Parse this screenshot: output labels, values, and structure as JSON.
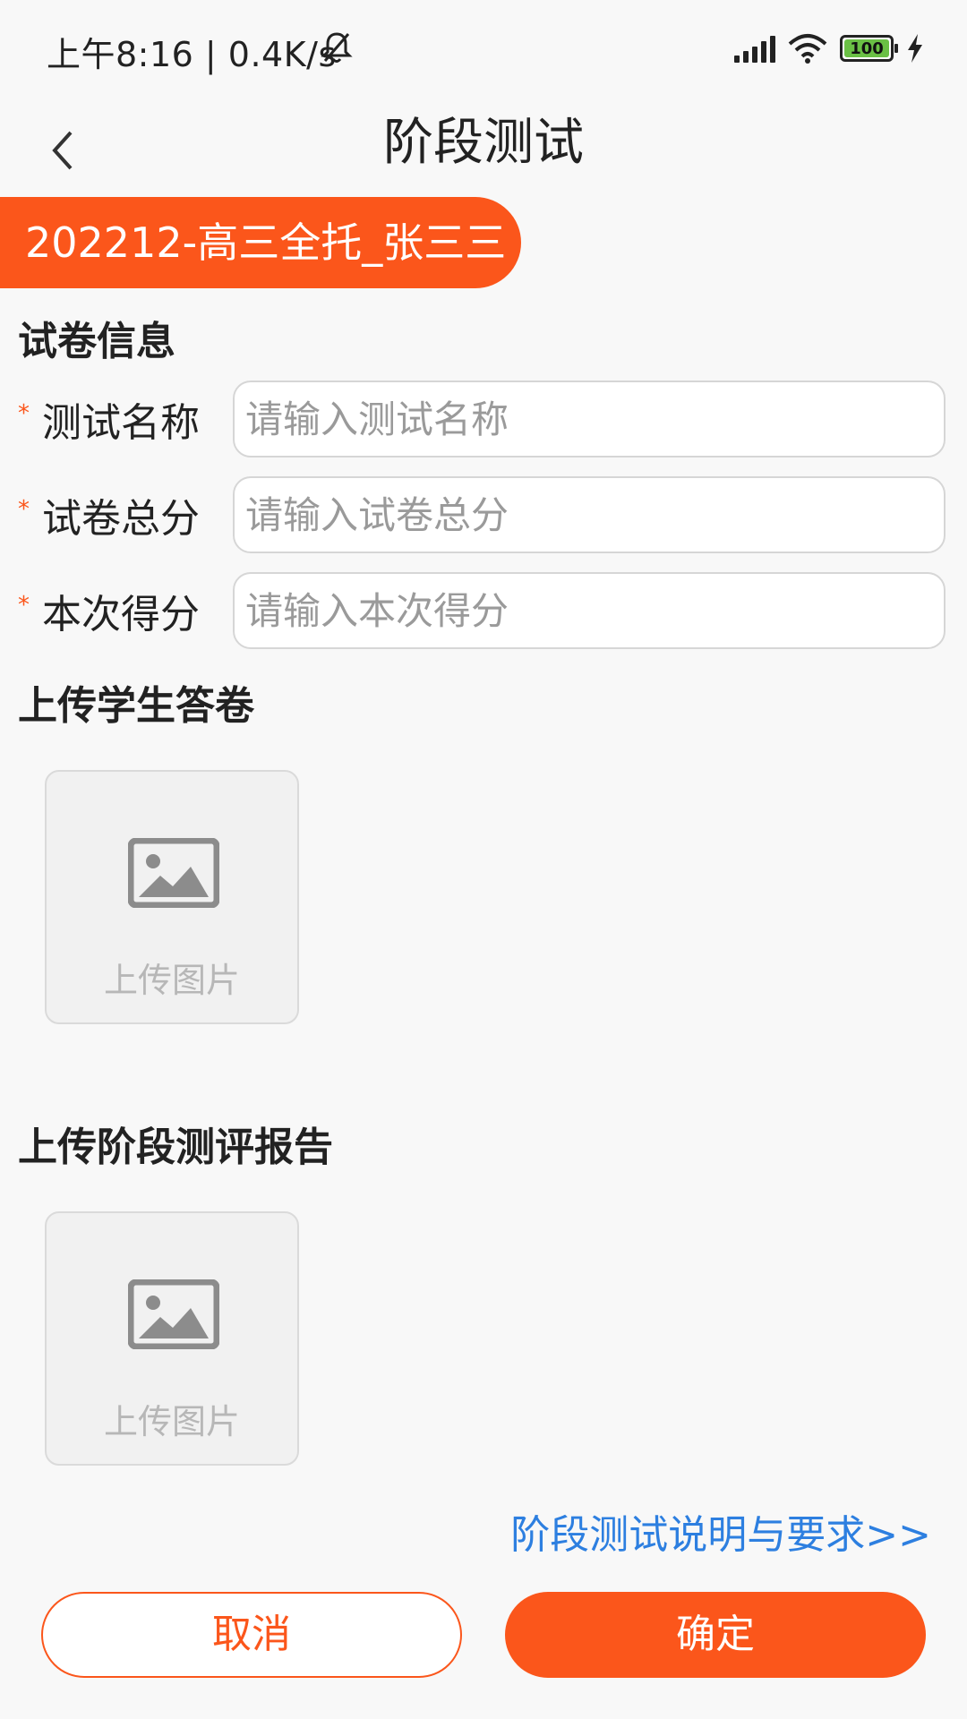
{
  "status_bar": {
    "time": "上午8:16 | 0.4K/s",
    "battery": "100"
  },
  "header": {
    "title": "阶段测试"
  },
  "class_tag": "202212-高三全托_张三三",
  "paper_info": {
    "section_title": "试卷信息",
    "required_mark": "*",
    "fields": [
      {
        "label": "测试名称",
        "placeholder": "请输入测试名称",
        "value": ""
      },
      {
        "label": "试卷总分",
        "placeholder": "请输入试卷总分",
        "value": ""
      },
      {
        "label": "本次得分",
        "placeholder": "请输入本次得分",
        "value": ""
      }
    ]
  },
  "upload_answer": {
    "section_title": "上传学生答卷",
    "upload_label": "上传图片"
  },
  "upload_report": {
    "section_title": "上传阶段测评报告",
    "upload_label": "上传图片"
  },
  "info_link": "阶段测试说明与要求>>",
  "buttons": {
    "cancel": "取消",
    "confirm": "确定"
  },
  "colors": {
    "accent": "#fb561b",
    "link": "#2d7fe0"
  }
}
